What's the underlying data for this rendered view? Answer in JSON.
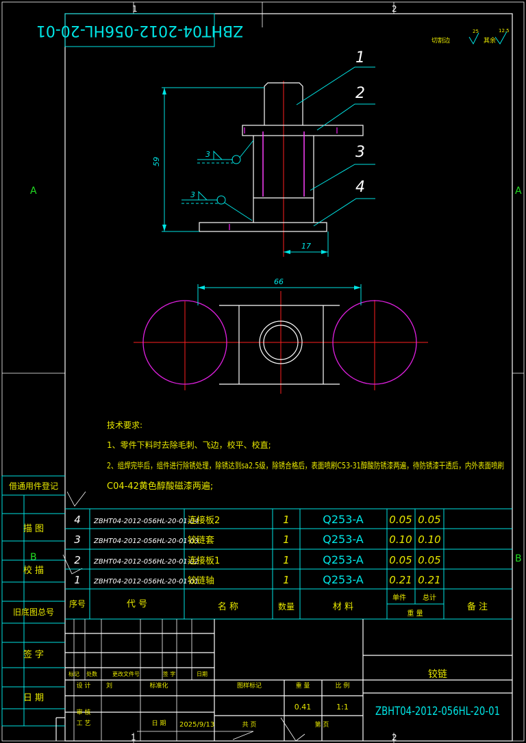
{
  "drawing_number_rotated": "ZBHT04-2012-056HL-20-01",
  "zone_labels": {
    "top_1": "1",
    "top_2": "2",
    "bottom_1": "1",
    "bottom_2": "2",
    "left_A": "A",
    "right_A": "A",
    "left_B": "B",
    "right_B": "B"
  },
  "surface_finish_note": {
    "other_label": "切割边",
    "other_value": "25",
    "rest_label": "其余",
    "rest_value": "12.5"
  },
  "balloons": [
    "1",
    "2",
    "3",
    "4"
  ],
  "dimensions": {
    "height": "59",
    "offset": "17",
    "span": "66"
  },
  "weld_symbols": [
    "3",
    "3"
  ],
  "technical_requirements": {
    "title": "技术要求:",
    "item1": "1、零件下料时去除毛刺、飞边，校平、校直;",
    "item2_line1": "2、组焊完毕后，组件进行除锈处理，除锈达到sa2.5级，除锈合格后，表面喷刷C53-31醇酸防锈漆两遍，待防锈漆干透后，内外表面喷刷",
    "item2_line2": "C04-42黄色醇酸磁漆两遍;"
  },
  "left_side_stamps": [
    "借通用件登记",
    "描  图",
    "校  描",
    "旧底图总号",
    "签  字",
    "日  期"
  ],
  "parts_list": {
    "rows": [
      {
        "seq": "4",
        "code": "ZBHT04-2012-056HL-20-01-04",
        "name": "连接板2",
        "qty": "1",
        "material": "Q253-A",
        "unit_weight": "0.05",
        "total_weight": "0.05"
      },
      {
        "seq": "3",
        "code": "ZBHT04-2012-056HL-20-01-03",
        "name": "铰链套",
        "qty": "1",
        "material": "Q253-A",
        "unit_weight": "0.10",
        "total_weight": "0.10"
      },
      {
        "seq": "2",
        "code": "ZBHT04-2012-056HL-20-01-02",
        "name": "连接板1",
        "qty": "1",
        "material": "Q253-A",
        "unit_weight": "0.05",
        "total_weight": "0.05"
      },
      {
        "seq": "1",
        "code": "ZBHT04-2012-056HL-20-01-01",
        "name": "铰链轴",
        "qty": "1",
        "material": "Q253-A",
        "unit_weight": "0.21",
        "total_weight": "0.21"
      }
    ],
    "headers": {
      "seq": "序号",
      "code": "代    号",
      "name": "名      称",
      "qty": "数量",
      "material": "材    料",
      "unit": "单件",
      "total": "总计",
      "weight": "重    量",
      "remark": "备    注"
    }
  },
  "title_block": {
    "labels": {
      "mark": "标记",
      "count": "处数",
      "change_doc": "更改文件号",
      "sign": "签 字",
      "date": "日期",
      "design": "设 计",
      "standardize": "标准化",
      "review": "审 核",
      "process": "工 艺",
      "date2": "日 期",
      "stage_mark": "图样标记",
      "weight": "重 量",
      "scale": "比 例",
      "sheets": "共   页",
      "sheet": "第   页"
    },
    "designer": "刘",
    "date_value": "2025/9/13",
    "weight_value": "0.41",
    "scale_value": "1:1",
    "part_name": "铰链",
    "drawing_number": "ZBHT04-2012-056HL-20-01"
  }
}
